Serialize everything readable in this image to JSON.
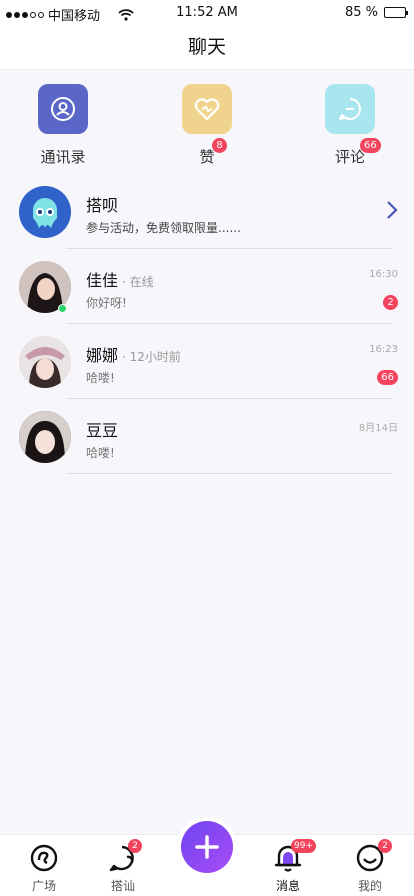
{
  "status_bar": {
    "carrier": "中国移动",
    "time": "11:52 AM",
    "battery": "85 %",
    "battery_level": 0.85
  },
  "nav": {
    "title": "聊天"
  },
  "quick_actions": [
    {
      "label": "通讯录",
      "icon": "contacts-icon",
      "color": "#5a67c8",
      "badge": ""
    },
    {
      "label": "赞",
      "icon": "heart-icon",
      "color": "#f0d38c",
      "badge": "8"
    },
    {
      "label": "评论",
      "icon": "comment-icon",
      "color": "#a8e6ef",
      "badge": "66"
    }
  ],
  "conversations": [
    {
      "name": "搭呗",
      "status": "",
      "message": "参与活动，免费领取限量......",
      "time": "",
      "badge": ""
    },
    {
      "name": "佳佳",
      "status": "· 在线",
      "message": "你好呀!",
      "time": "16:30",
      "badge": "2"
    },
    {
      "name": "娜娜",
      "status": "· 12小时前",
      "message": "哈喽!",
      "time": "16:23",
      "badge": "66"
    },
    {
      "name": "豆豆",
      "status": "",
      "message": "哈喽!",
      "time": "8月14日",
      "badge": ""
    }
  ],
  "tabbar": {
    "items": [
      {
        "label": "广场",
        "badge": ""
      },
      {
        "label": "搭讪",
        "badge": "2"
      },
      {
        "label": "消息",
        "badge": "99+"
      },
      {
        "label": "我的",
        "badge": "2"
      }
    ],
    "accent": "#7b48f3"
  }
}
